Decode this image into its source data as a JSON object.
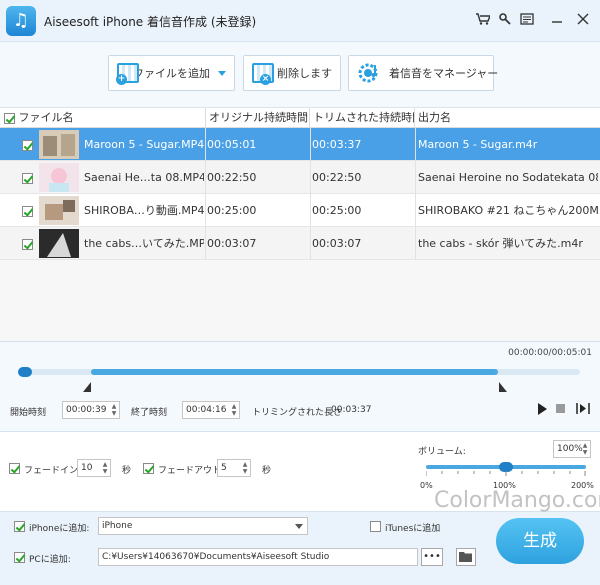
{
  "window": {
    "title": "Aiseesoft iPhone 着信音作成 (未登録)"
  },
  "toolbar": {
    "add_file_label": "ファイルを追加",
    "delete_label": "削除します",
    "manager_label": "着信音をマネージャー"
  },
  "table": {
    "columns": [
      "ファイル名",
      "オリジナル持続時間",
      "トリムされた持続時間",
      "出力名"
    ],
    "rows": [
      {
        "name": "Maroon 5 - Sugar.MP4",
        "original": "00:05:01",
        "trimmed": "00:03:37",
        "output": "Maroon 5 - Sugar.m4r",
        "checked": true,
        "selected": true
      },
      {
        "name": "Saenai He…ta 08.MP4",
        "original": "00:22:50",
        "trimmed": "00:22:50",
        "output": "Saenai Heroine no Sodatekata 08…",
        "checked": true,
        "selected": false
      },
      {
        "name": "SHIROBA…り動画.MP4",
        "original": "00:25:00",
        "trimmed": "00:25:00",
        "output": "SHIROBAKO #21 ねこちゃん200M…",
        "checked": true,
        "selected": false
      },
      {
        "name": "the cabs…いてみた.MP4",
        "original": "00:03:07",
        "trimmed": "00:03:07",
        "output": "the cabs - skór 弾いてみた.m4r",
        "checked": true,
        "selected": false
      }
    ]
  },
  "timeline": {
    "time_readout": "00:00:00/00:05:01",
    "progress": 0.0,
    "trim_start_fraction": 0.13,
    "trim_end_fraction": 0.855,
    "start_label": "開始時刻",
    "start_value": "00:00:39",
    "end_label": "終了時刻",
    "end_value": "00:04:16",
    "trimmed_length_label": "トリミングされた長さ",
    "trimmed_length_value": "00:03:37"
  },
  "effects": {
    "fade_in_label": "フェードイン",
    "fade_in_value": "10",
    "fade_in_unit": "秒",
    "fade_out_label": "フェードアウト",
    "fade_out_value": "5",
    "fade_out_unit": "秒",
    "volume_label": "ボリューム:",
    "volume_value": "100%",
    "volume_fraction": 0.5,
    "volume_min": "0%",
    "volume_mid": "100%",
    "volume_max": "200%"
  },
  "output": {
    "iphone_label": "iPhoneに追加:",
    "iphone_value": "iPhone",
    "itunes_label": "iTunesに追加",
    "pc_label": "PCに追加:",
    "pc_path": "C:¥Users¥14063670¥Documents¥Aiseesoft Studio",
    "browse_label": "•••",
    "generate_label": "生成"
  },
  "watermark": "ColorMango.com",
  "colors": {
    "accent": "#4aa0e6",
    "check": "#2aa52a",
    "generate": "#3ab0e8"
  }
}
